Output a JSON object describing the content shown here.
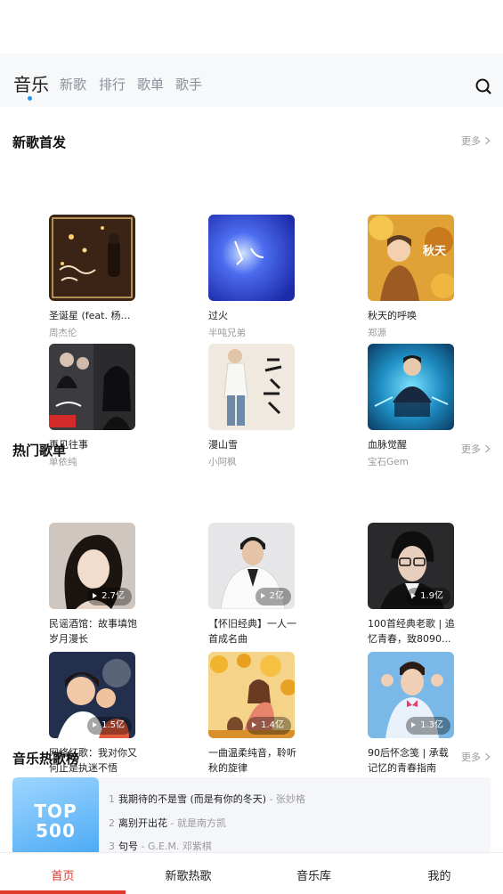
{
  "top_tabs": [
    "音乐",
    "新歌",
    "排行",
    "歌单",
    "歌手"
  ],
  "accent_color": "#2196f3",
  "new_songs": {
    "title": "新歌首发",
    "more": "更多",
    "items": [
      {
        "title": "圣诞星 (feat. 杨瑞代)",
        "artist": "周杰伦"
      },
      {
        "title": "过火",
        "artist": "半吨兄弟"
      },
      {
        "title": "秋天的呼唤",
        "artist": "郑源"
      },
      {
        "title": "再见往事",
        "artist": "单依纯"
      },
      {
        "title": "漫山雪",
        "artist": "小阿枫"
      },
      {
        "title": "血脉觉醒",
        "artist": "宝石Gem"
      }
    ]
  },
  "hot_playlists": {
    "title": "热门歌单",
    "more": "更多",
    "items": [
      {
        "title": "民谣酒馆：故事填饱岁月漫长",
        "plays": "2.7亿"
      },
      {
        "title": "【怀旧经典】一人一首成名曲",
        "plays": "2亿"
      },
      {
        "title": "100首经典老歌 | 追忆青春，致8090...",
        "plays": "1.9亿"
      },
      {
        "title": "网络红歌：我对你又何止是执迷不悟",
        "plays": "1.5亿"
      },
      {
        "title": "一曲温柔纯音，聆听秋的旋律",
        "plays": "1.4亿"
      },
      {
        "title": "90后怀念笺 | 承载记忆的青春指南",
        "plays": "1.3亿"
      }
    ]
  },
  "hot_chart": {
    "title": "音乐热歌榜",
    "more": "更多",
    "cover_line1": "TOP",
    "cover_line2": "500",
    "rows": [
      {
        "num": "1",
        "song": "我期待的不是雪 (而是有你的冬天)",
        "artist": " - 张妙格"
      },
      {
        "num": "2",
        "song": "离别开出花",
        "artist": " - 就是南方凯"
      },
      {
        "num": "3",
        "song": "句号",
        "artist": " - G.E.M. 邓紫棋"
      }
    ]
  },
  "bottom_nav": [
    "首页",
    "新歌热歌",
    "音乐库",
    "我的"
  ],
  "bottom_active_color": "#e0382b",
  "icons": {
    "search": "search-icon",
    "more": "chevron-right-icon",
    "play": "play-icon"
  }
}
